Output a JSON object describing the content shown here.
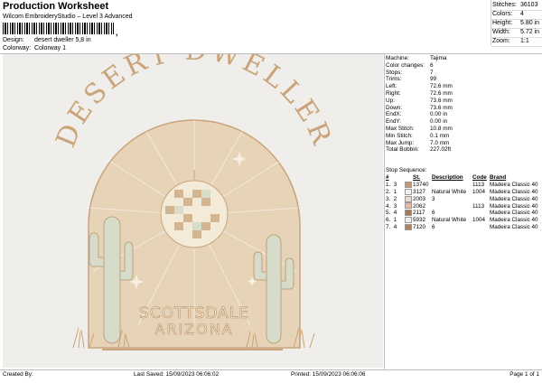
{
  "header": {
    "title": "Production Worksheet",
    "subtitle": "Wilcom EmbroideryStudio – Level 3 Advanced",
    "barcode_mark": ","
  },
  "info": [
    {
      "label": "Design:",
      "value": "desert dweller 5,8 in"
    },
    {
      "label": "Colorway:",
      "value": "Colorway 1"
    }
  ],
  "stats": [
    {
      "label": "Stitches:",
      "value": "36103"
    },
    {
      "label": "Colors:",
      "value": "4"
    },
    {
      "label": "Height:",
      "value": "5.80 in"
    },
    {
      "label": "Width:",
      "value": "5.72 in"
    },
    {
      "label": "Zoom:",
      "value": "1:1"
    }
  ],
  "artwork": {
    "arc_text": "DESERT DWELLER",
    "line1": "SCOTTSDALE",
    "line2": "ARIZONA",
    "colors": {
      "tan": "#c9a47a",
      "beige": "#e7d3b8",
      "cream": "#f3ead8",
      "sage": "#d6dcc9",
      "background": "#efeeeb"
    }
  },
  "params": [
    {
      "label": "Machine:",
      "value": "Tajima"
    },
    {
      "label": "Color changes:",
      "value": "6"
    },
    {
      "label": "Stops:",
      "value": "7"
    },
    {
      "label": "Trims:",
      "value": "99"
    },
    {
      "label": "Left:",
      "value": "72.6 mm"
    },
    {
      "label": "Right:",
      "value": "72.6 mm"
    },
    {
      "label": "Up:",
      "value": "73.6 mm"
    },
    {
      "label": "Down:",
      "value": "73.6 mm"
    },
    {
      "label": "EndX:",
      "value": "0.00 in"
    },
    {
      "label": "EndY:",
      "value": "0.00 in"
    },
    {
      "label": "Max Stitch:",
      "value": "10.8 mm"
    },
    {
      "label": "Min Stitch:",
      "value": "0.1 mm"
    },
    {
      "label": "Max Jump:",
      "value": "7.0 mm"
    },
    {
      "label": "Total Bobbin:",
      "value": "227.02ft"
    }
  ],
  "stop_sequence": {
    "label": "Stop Sequence:",
    "columns": [
      "#",
      "St.",
      "Description",
      "Code",
      "Brand"
    ],
    "rows": [
      {
        "n": "1.",
        "s": "3",
        "color": "#c9956a",
        "st": "13740",
        "desc": "",
        "code": "1113",
        "brand": "Madeira Classic 40"
      },
      {
        "n": "2.",
        "s": "1",
        "color": "#f2f0ea",
        "st": "3127",
        "desc": "Natural White",
        "code": "1004",
        "brand": "Madeira Classic 40"
      },
      {
        "n": "3.",
        "s": "2",
        "color": "#e9ddd0",
        "st": "2003",
        "desc": "3",
        "code": "",
        "brand": "Madeira Classic 40"
      },
      {
        "n": "4.",
        "s": "3",
        "color": "#e8b8a6",
        "st": "2062",
        "desc": "",
        "code": "1113",
        "brand": "Madeira Classic 40"
      },
      {
        "n": "5.",
        "s": "4",
        "color": "#a77a4e",
        "st": "2117",
        "desc": "6",
        "code": "",
        "brand": "Madeira Classic 40"
      },
      {
        "n": "6.",
        "s": "1",
        "color": "#eeeeee",
        "st": "5932",
        "desc": "Natural White",
        "code": "1004",
        "brand": "Madeira Classic 40"
      },
      {
        "n": "7.",
        "s": "4",
        "color": "#b0845a",
        "st": "7120",
        "desc": "6",
        "code": "",
        "brand": "Madeira Classic 40"
      }
    ]
  },
  "footer": {
    "created_by": "Created By:",
    "last_saved": "Last Saved: 15/09/2023 06:06:02",
    "printed": "Printed: 15/09/2023 06:06:06",
    "page": "Page 1 of 1"
  }
}
